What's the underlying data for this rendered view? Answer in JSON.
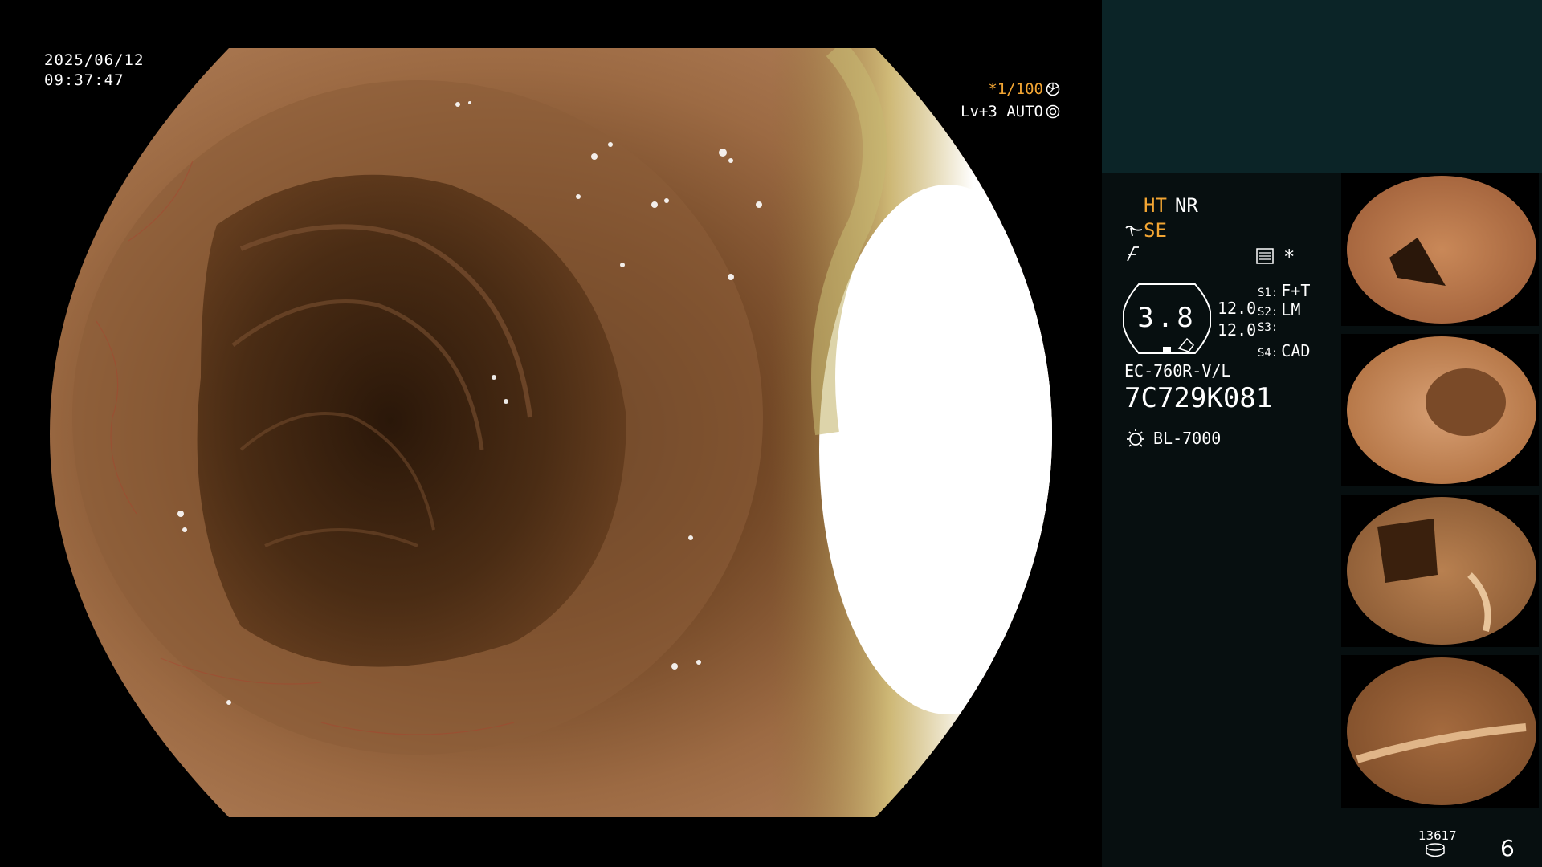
{
  "main": {
    "date": "2025/06/12",
    "time": "09:37:47",
    "shutter": "*1/100",
    "shutter_icon": "aperture-icon",
    "level": "Lv+3 AUTO",
    "level_icon": "auto-iris-icon"
  },
  "panel": {
    "ht": "HT",
    "nr": "NR",
    "se": "SE",
    "se_icon": "enhancement-icon",
    "f_icon": "function-icon",
    "menu_icon": "settings-menu-icon",
    "star": "*",
    "structure_value": "3.8",
    "se_values": [
      "12.0",
      "12.0"
    ],
    "scope_keys": [
      {
        "key": "S1:",
        "value": "F+T"
      },
      {
        "key": "S2:",
        "value": "LM"
      },
      {
        "key": "S3:",
        "value": ""
      },
      {
        "key": "S4:",
        "value": "CAD"
      }
    ],
    "scope_model": "EC-760R-V/L",
    "scope_serial": "7C729K081",
    "light_source": "BL-7000",
    "light_icon": "light-source-icon"
  },
  "footer": {
    "disk_count": "13617",
    "disk_icon": "storage-icon",
    "page": "6"
  },
  "colors": {
    "accent": "#f2a533",
    "panel_bg": "#070f10",
    "panel_top": "#0b2427",
    "tissue": "#b07a4f"
  }
}
